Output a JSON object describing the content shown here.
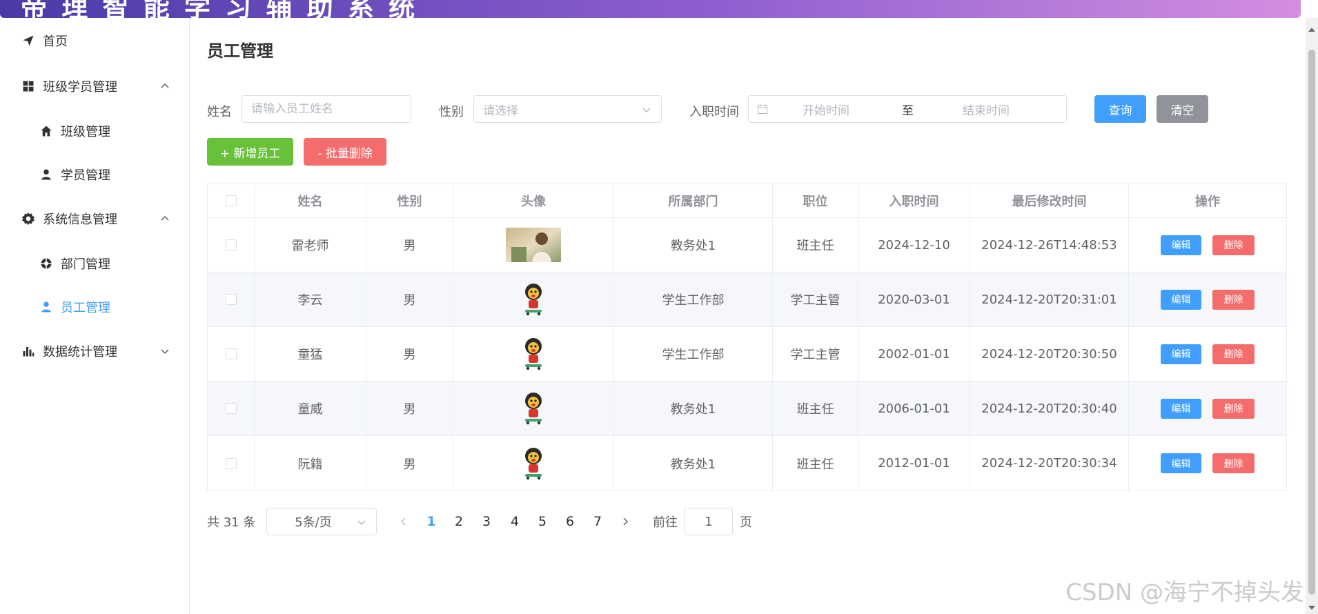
{
  "app": {
    "title": "帝 理 智 能 学 习 辅 助 系 统"
  },
  "sidebar": {
    "items": [
      {
        "label": "首页",
        "icon": "paper-plane-icon"
      },
      {
        "label": "班级学员管理",
        "icon": "grid-icon",
        "expanded": true
      },
      {
        "label": "班级管理",
        "icon": "home-icon"
      },
      {
        "label": "学员管理",
        "icon": "user-icon"
      },
      {
        "label": "系统信息管理",
        "icon": "gear-icon",
        "expanded": true
      },
      {
        "label": "部门管理",
        "icon": "department-icon"
      },
      {
        "label": "员工管理",
        "icon": "user-icon",
        "active": true
      },
      {
        "label": "数据统计管理",
        "icon": "bar-chart-icon",
        "expanded": false
      }
    ]
  },
  "main": {
    "title": "员工管理",
    "filters": {
      "name_label": "姓名",
      "name_placeholder": "请输入员工姓名",
      "gender_label": "性别",
      "gender_placeholder": "请选择",
      "date_label": "入职时间",
      "date_start_placeholder": "开始时间",
      "date_separator": "至",
      "date_end_placeholder": "结束时间",
      "search_button": "查询",
      "clear_button": "清空"
    },
    "actions": {
      "add_button": "+ 新增员工",
      "batch_delete_button": "- 批量删除"
    },
    "table": {
      "columns": [
        "姓名",
        "性别",
        "头像",
        "所属部门",
        "职位",
        "入职时间",
        "最后修改时间",
        "操作"
      ],
      "edit_label": "编辑",
      "delete_label": "删除",
      "rows": [
        {
          "name": "雷老师",
          "gender": "男",
          "avatar": "photo",
          "dept": "教务处1",
          "position": "班主任",
          "entry_date": "2024-12-10",
          "updated": "2024-12-26T14:48:53"
        },
        {
          "name": "李云",
          "gender": "男",
          "avatar": "mascot",
          "dept": "学生工作部",
          "position": "学工主管",
          "entry_date": "2020-03-01",
          "updated": "2024-12-20T20:31:01"
        },
        {
          "name": "童猛",
          "gender": "男",
          "avatar": "mascot",
          "dept": "学生工作部",
          "position": "学工主管",
          "entry_date": "2002-01-01",
          "updated": "2024-12-20T20:30:50"
        },
        {
          "name": "童威",
          "gender": "男",
          "avatar": "mascot",
          "dept": "教务处1",
          "position": "班主任",
          "entry_date": "2006-01-01",
          "updated": "2024-12-20T20:30:40"
        },
        {
          "name": "阮籍",
          "gender": "男",
          "avatar": "mascot",
          "dept": "教务处1",
          "position": "班主任",
          "entry_date": "2012-01-01",
          "updated": "2024-12-20T20:30:34"
        }
      ]
    },
    "pagination": {
      "total_label": "共 31 条",
      "page_size": "5条/页",
      "pages": [
        "1",
        "2",
        "3",
        "4",
        "5",
        "6",
        "7"
      ],
      "current_page": "1",
      "goto_label": "前往",
      "goto_value": "1",
      "page_suffix": "页"
    }
  },
  "watermark": "CSDN @海宁不掉头发",
  "colors": {
    "primary": "#409eff",
    "success": "#67c23a",
    "danger": "#f56c6c",
    "info": "#909399"
  }
}
